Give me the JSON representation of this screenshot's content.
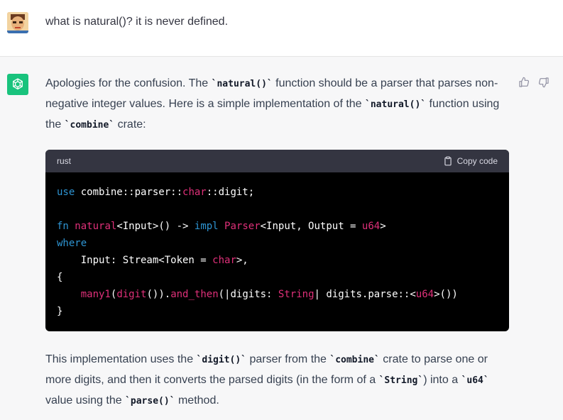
{
  "user": {
    "message": "what is natural()? it is never defined."
  },
  "assistant": {
    "para1": {
      "t1": "Apologies for the confusion. The ",
      "c1": "`natural()`",
      "t2": " function should be a parser that parses non-negative integer values. Here is a simple implementation of the ",
      "c2": "`natural()`",
      "t3": " function using the ",
      "c3": "`combine`",
      "t4": " crate:"
    },
    "code": {
      "language": "rust",
      "copy_label": "Copy code",
      "lines": [
        [
          {
            "t": "use",
            "c": "kw"
          },
          {
            "t": " combine::parser::",
            "c": "white"
          },
          {
            "t": "char",
            "c": "red"
          },
          {
            "t": "::digit;",
            "c": "white"
          }
        ],
        [
          {
            "t": "",
            "c": "white"
          }
        ],
        [
          {
            "t": "fn",
            "c": "kw"
          },
          {
            "t": " ",
            "c": "white"
          },
          {
            "t": "natural",
            "c": "red"
          },
          {
            "t": "<Input>() -> ",
            "c": "white"
          },
          {
            "t": "impl",
            "c": "kw"
          },
          {
            "t": " ",
            "c": "white"
          },
          {
            "t": "Parser",
            "c": "red"
          },
          {
            "t": "<Input, Output = ",
            "c": "white"
          },
          {
            "t": "u64",
            "c": "red"
          },
          {
            "t": ">",
            "c": "white"
          }
        ],
        [
          {
            "t": "where",
            "c": "kw"
          }
        ],
        [
          {
            "t": "    Input: Stream<Token = ",
            "c": "white"
          },
          {
            "t": "char",
            "c": "red"
          },
          {
            "t": ">,",
            "c": "white"
          }
        ],
        [
          {
            "t": "{",
            "c": "white"
          }
        ],
        [
          {
            "t": "    ",
            "c": "white"
          },
          {
            "t": "many1",
            "c": "red"
          },
          {
            "t": "(",
            "c": "white"
          },
          {
            "t": "digit",
            "c": "red"
          },
          {
            "t": "()).",
            "c": "white"
          },
          {
            "t": "and_then",
            "c": "red"
          },
          {
            "t": "(|digits: ",
            "c": "white"
          },
          {
            "t": "String",
            "c": "red"
          },
          {
            "t": "| digits.parse::<",
            "c": "white"
          },
          {
            "t": "u64",
            "c": "red"
          },
          {
            "t": ">())",
            "c": "white"
          }
        ],
        [
          {
            "t": "}",
            "c": "white"
          }
        ]
      ]
    },
    "para2": {
      "t1": "This implementation uses the ",
      "c1": "`digit()`",
      "t2": " parser from the ",
      "c2": "`combine`",
      "t3": " crate to parse one or more digits, and then it converts the parsed digits (in the form of a ",
      "c3": "`String`",
      "t4": ") into a ",
      "c4": "`u64`",
      "t5": " value using the ",
      "c5": "`parse()`",
      "t6": " method."
    }
  },
  "icons": {
    "user_avatar": "user-avatar-icon",
    "assistant_avatar": "openai-logo-icon",
    "thumbs_up": "thumbs-up-icon",
    "thumbs_down": "thumbs-down-icon",
    "clipboard": "clipboard-icon"
  },
  "colors": {
    "assistant_avatar_bg": "#19c37d",
    "code_bg": "#000000",
    "code_header_bg": "#343541",
    "keyword": "#2e95d3",
    "type_fn": "#df3079"
  }
}
